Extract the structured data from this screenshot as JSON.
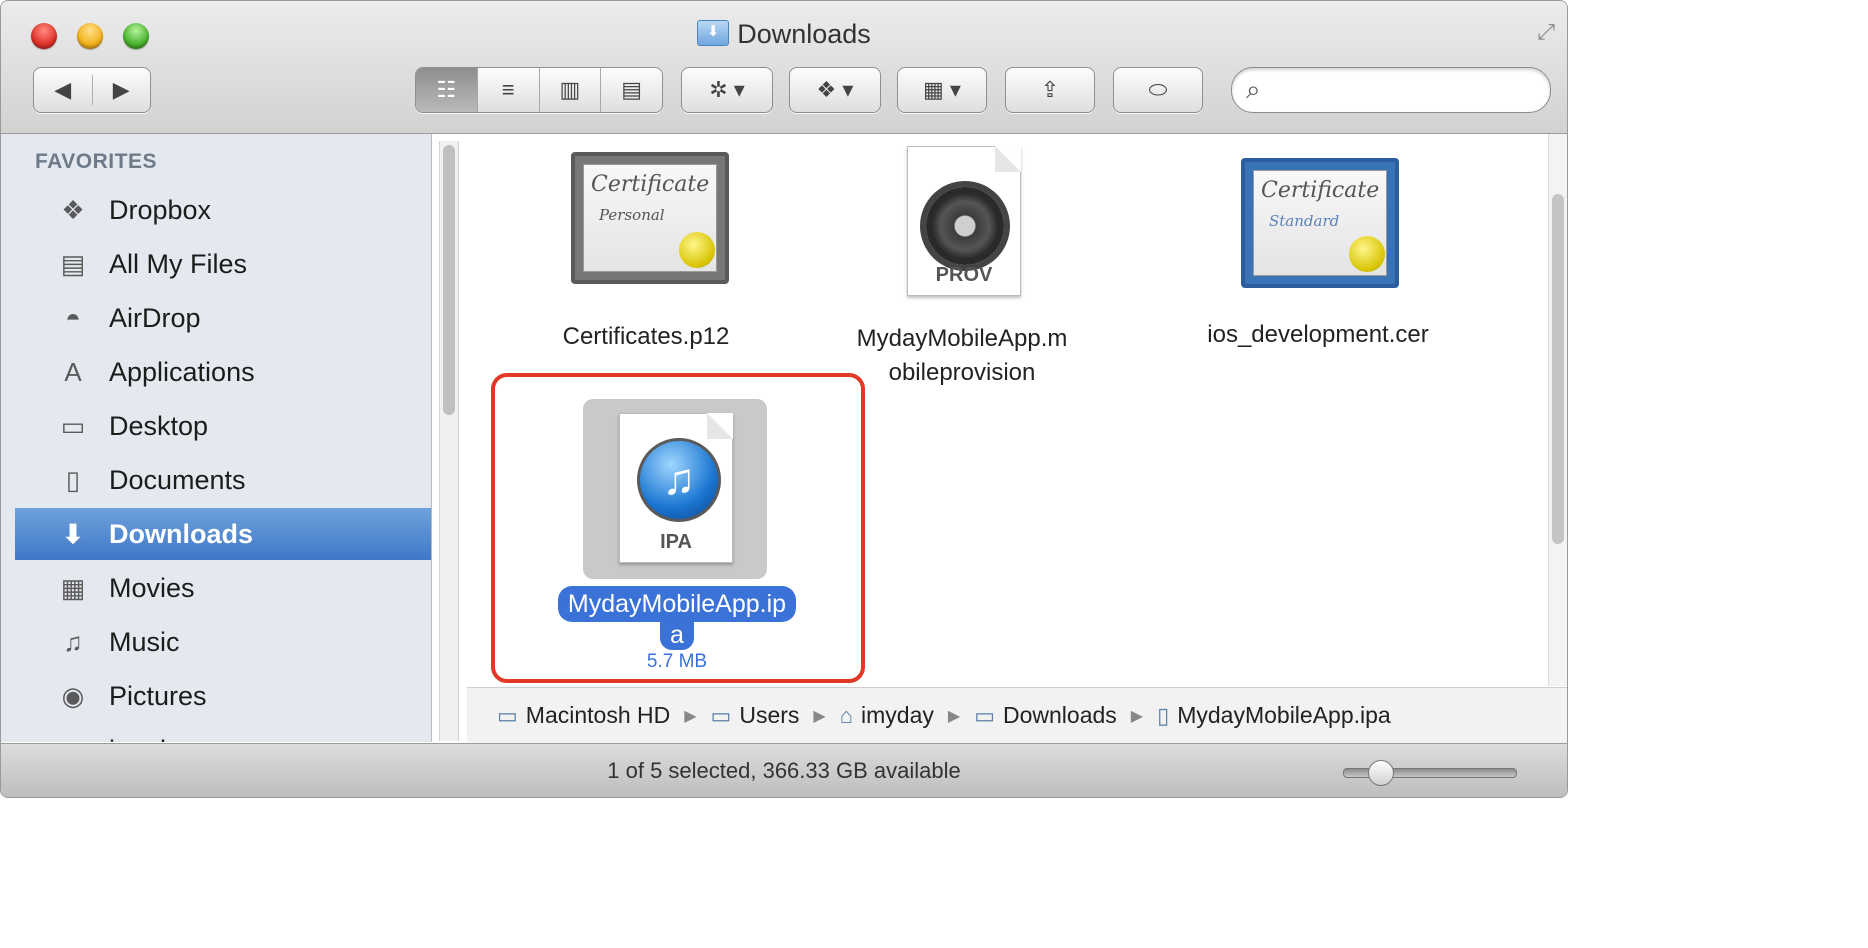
{
  "window": {
    "title": "Downloads"
  },
  "toolbar": {
    "back_icon": "◀",
    "forward_icon": "▶",
    "view_icons": [
      "☷",
      "≡",
      "▥",
      "▤"
    ],
    "action_icon": "✲ ▾",
    "dropbox_icon": "❖ ▾",
    "arrange_icon": "▦ ▾",
    "share_icon": "⇪",
    "label_icon": "⬭",
    "search_placeholder": "",
    "search_value": ""
  },
  "sidebar": {
    "heading": "FAVORITES",
    "items": [
      {
        "label": "Dropbox",
        "icon": "❖"
      },
      {
        "label": "All My Files",
        "icon": "▤"
      },
      {
        "label": "AirDrop",
        "icon": "◓"
      },
      {
        "label": "Applications",
        "icon": "A"
      },
      {
        "label": "Desktop",
        "icon": "▭"
      },
      {
        "label": "Documents",
        "icon": "▯"
      },
      {
        "label": "Downloads",
        "icon": "⬇"
      },
      {
        "label": "Movies",
        "icon": "▦"
      },
      {
        "label": "Music",
        "icon": "♫"
      },
      {
        "label": "Pictures",
        "icon": "◉"
      },
      {
        "label": "imyday",
        "icon": "⌂"
      }
    ],
    "selected": "Downloads"
  },
  "files": [
    {
      "name": "Certificates.p12",
      "kind": "certificate-personal",
      "cert_text": "Certificate",
      "cert_sub": "Personal"
    },
    {
      "name_line1": "MydayMobileApp.m",
      "name_line2": "obileprovision",
      "kind": "provisioning-profile",
      "tag": "PROV"
    },
    {
      "name": "ios_development.cer",
      "kind": "certificate-standard",
      "cert_text": "Certificate",
      "cert_sub": "Standard"
    },
    {
      "name_line1": "MydayMobileApp.ip",
      "name_line2": "a",
      "kind": "ipa",
      "tag": "IPA",
      "size": "5.7 MB",
      "selected": true
    }
  ],
  "pathbar": {
    "segments": [
      "Macintosh HD",
      "Users",
      "imyday",
      "Downloads",
      "MydayMobileApp.ipa"
    ]
  },
  "status": {
    "text": "1 of 5 selected, 366.33 GB available",
    "zoom_level": 0.2
  },
  "colors": {
    "selection": "#3a72d8",
    "highlight_border": "#e03a25",
    "sidebar_selected": "#3f78c7"
  }
}
